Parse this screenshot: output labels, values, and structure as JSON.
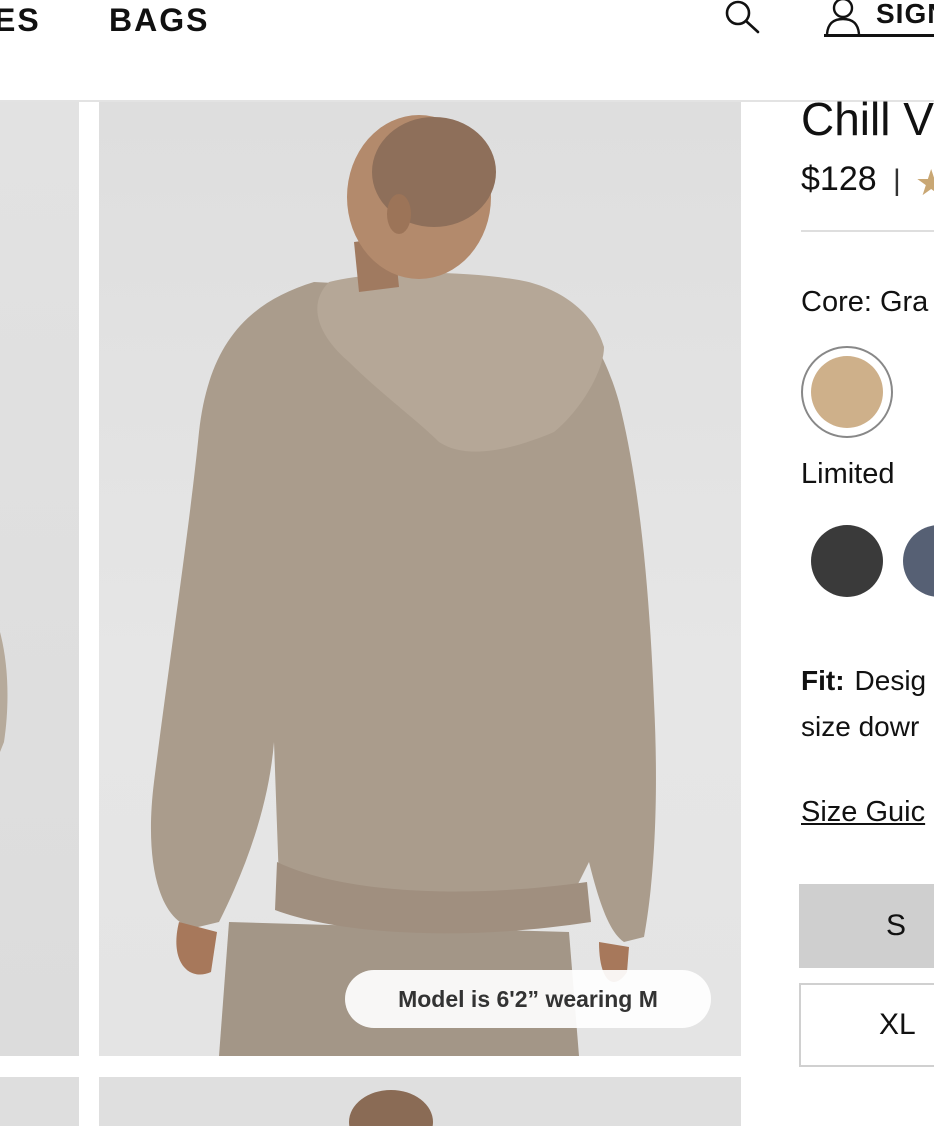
{
  "header": {
    "nav_items": [
      "ES",
      "BAGS"
    ],
    "signin_label": "SIGN"
  },
  "gallery": {
    "model_caption": "Model is 6'2” wearing M"
  },
  "product": {
    "title": "Chill V",
    "price": "$128",
    "price_separator": "|",
    "rating_star": "★"
  },
  "colors": {
    "core_label": "Core: Gra",
    "limited_label": "Limited",
    "swatches": {
      "core_selected": "#ceb08a",
      "limited_black": "#3a3a3a",
      "limited_blue": "#566074"
    }
  },
  "fit": {
    "label": "Fit:",
    "line1": "Desig",
    "line2": "size dowr"
  },
  "sizes": {
    "guide_label": "Size Guic",
    "options": [
      "S",
      "XL"
    ]
  }
}
